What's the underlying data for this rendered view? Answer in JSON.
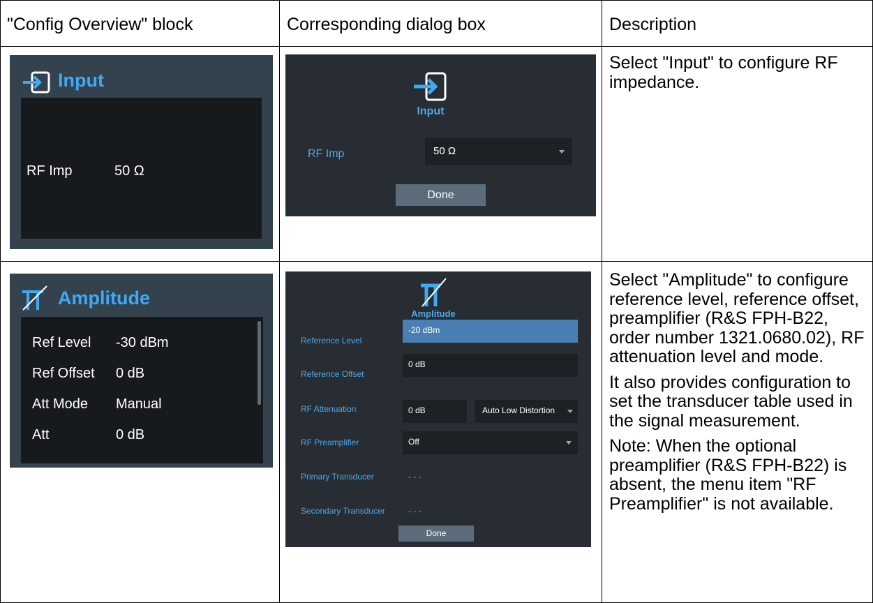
{
  "headers": {
    "col1": "\"Config Overview\" block",
    "col2": "Corresponding dialog box",
    "col3": "Description"
  },
  "row1": {
    "overview": {
      "title": "Input",
      "param_label": "RF Imp",
      "param_value": "50 Ω"
    },
    "dialog": {
      "caption": "Input",
      "field_label": "RF Imp",
      "field_value": "50 Ω",
      "done_label": "Done"
    },
    "description": "Select \"Input\" to configure RF impedance."
  },
  "row2": {
    "overview": {
      "title": "Amplitude",
      "rows": [
        {
          "label": "Ref Level",
          "value": "-30 dBm"
        },
        {
          "label": "Ref Offset",
          "value": "0 dB"
        },
        {
          "label": "Att Mode",
          "value": "Manual"
        },
        {
          "label": "Att",
          "value": "0 dB"
        }
      ]
    },
    "dialog": {
      "caption": "Amplitude",
      "reference_level_label": "Reference Level",
      "reference_level_value": "-20 dBm",
      "reference_offset_label": "Reference Offset",
      "reference_offset_value": "0 dB",
      "rf_attenuation_label": "RF Attenuation",
      "rf_attenuation_value": "0 dB",
      "rf_attenuation_mode": "Auto Low Distortion",
      "rf_preamplifier_label": "RF Preamplifier",
      "rf_preamplifier_value": "Off",
      "primary_transducer_label": "Primary Transducer",
      "primary_transducer_value": "- - -",
      "secondary_transducer_label": "Secondary Transducer",
      "secondary_transducer_value": "- - -",
      "done_label": "Done"
    },
    "description": [
      "Select \"Amplitude\" to configure reference level, reference offset, preamplifier (R&S FPH-B22, order number 1321.0680.02), RF attenuation level and mode.",
      "It also provides configuration to set the transducer table used in the signal measurement.",
      "Note: When the optional preamplifier (R&S FPH-B22) is absent, the menu item \"RF Preamplifier\" is not available."
    ]
  },
  "colors": {
    "accent": "#3fa9f5",
    "panel": "#34424d",
    "dialog_bg": "#272d33",
    "button": "#5b6d7a"
  }
}
